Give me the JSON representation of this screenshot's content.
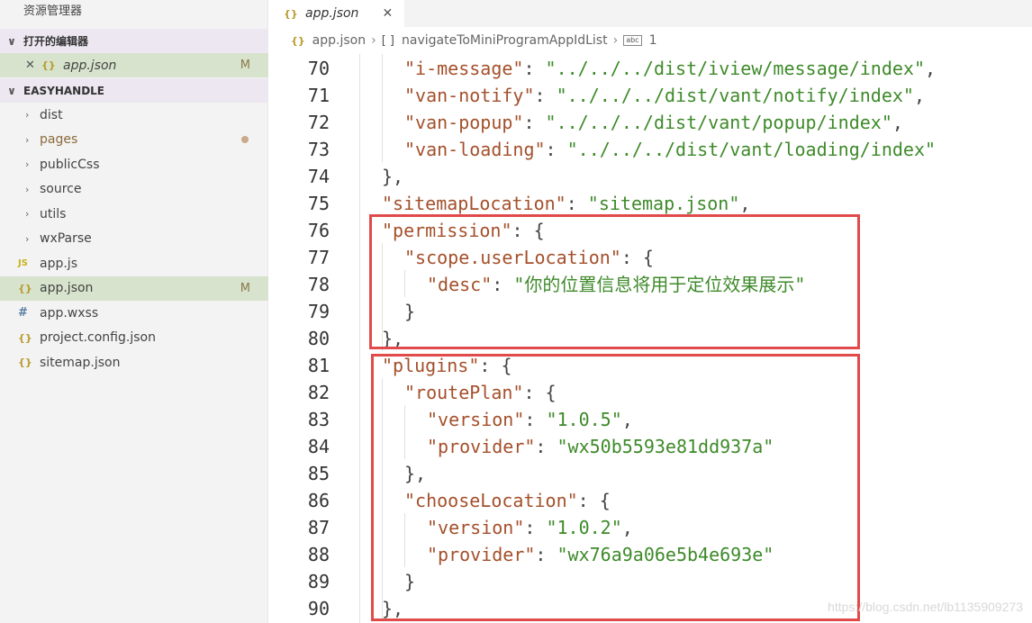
{
  "sidebar": {
    "title": "资源管理器",
    "open_editors_label": "打开的编辑器",
    "open_editors": [
      {
        "name": "app.json",
        "status": "M"
      }
    ],
    "project_label": "EASYHANDLE",
    "tree": [
      {
        "name": "dist",
        "type": "folder"
      },
      {
        "name": "pages",
        "type": "folder",
        "modified": true
      },
      {
        "name": "publicCss",
        "type": "folder"
      },
      {
        "name": "source",
        "type": "folder"
      },
      {
        "name": "utils",
        "type": "folder"
      },
      {
        "name": "wxParse",
        "type": "folder"
      },
      {
        "name": "app.js",
        "type": "js"
      },
      {
        "name": "app.json",
        "type": "json",
        "status": "M"
      },
      {
        "name": "app.wxss",
        "type": "css"
      },
      {
        "name": "project.config.json",
        "type": "json"
      },
      {
        "name": "sitemap.json",
        "type": "json"
      }
    ]
  },
  "tab": {
    "label": "app.json"
  },
  "breadcrumb": {
    "file": "app.json",
    "array": "navigateToMiniProgramAppIdList",
    "item": "1"
  },
  "icons": {
    "json": "{}",
    "js": "JS",
    "css": "#",
    "chevron_right": "›",
    "chevron_down": "∨",
    "close": "✕",
    "brackets": "[ ]",
    "abc": "abc"
  },
  "colors": {
    "key": "#a4502b",
    "string": "#3e8a2a",
    "highlight": "#e14a4a",
    "active_row": "#d7e3cc"
  },
  "editor": {
    "lines": [
      {
        "n": "70",
        "indent": 2,
        "tokens": [
          [
            "k",
            "\"i-message\""
          ],
          [
            "p",
            ": "
          ],
          [
            "s",
            "\"../../../dist/iview/message/index\""
          ],
          [
            "p",
            ","
          ]
        ]
      },
      {
        "n": "71",
        "indent": 2,
        "tokens": [
          [
            "k",
            "\"van-notify\""
          ],
          [
            "p",
            ": "
          ],
          [
            "s",
            "\"../../../dist/vant/notify/index\""
          ],
          [
            "p",
            ","
          ]
        ]
      },
      {
        "n": "72",
        "indent": 2,
        "tokens": [
          [
            "k",
            "\"van-popup\""
          ],
          [
            "p",
            ": "
          ],
          [
            "s",
            "\"../../../dist/vant/popup/index\""
          ],
          [
            "p",
            ","
          ]
        ]
      },
      {
        "n": "73",
        "indent": 2,
        "tokens": [
          [
            "k",
            "\"van-loading\""
          ],
          [
            "p",
            ": "
          ],
          [
            "s",
            "\"../../../dist/vant/loading/index\""
          ]
        ]
      },
      {
        "n": "74",
        "indent": 1,
        "tokens": [
          [
            "p",
            "},"
          ]
        ]
      },
      {
        "n": "75",
        "indent": 1,
        "tokens": [
          [
            "k",
            "\"sitemapLocation\""
          ],
          [
            "p",
            ": "
          ],
          [
            "s",
            "\"sitemap.json\""
          ],
          [
            "p",
            ","
          ]
        ]
      },
      {
        "n": "76",
        "indent": 1,
        "tokens": [
          [
            "k",
            "\"permission\""
          ],
          [
            "p",
            ": {"
          ]
        ]
      },
      {
        "n": "77",
        "indent": 2,
        "tokens": [
          [
            "k",
            "\"scope.userLocation\""
          ],
          [
            "p",
            ": {"
          ]
        ]
      },
      {
        "n": "78",
        "indent": 3,
        "tokens": [
          [
            "k",
            "\"desc\""
          ],
          [
            "p",
            ": "
          ],
          [
            "s",
            "\"你的位置信息将用于定位效果展示\""
          ]
        ]
      },
      {
        "n": "79",
        "indent": 2,
        "tokens": [
          [
            "p",
            "}"
          ]
        ]
      },
      {
        "n": "80",
        "indent": 1,
        "tokens": [
          [
            "p",
            "},"
          ]
        ]
      },
      {
        "n": "81",
        "indent": 1,
        "tokens": [
          [
            "k",
            "\"plugins\""
          ],
          [
            "p",
            ": {"
          ]
        ]
      },
      {
        "n": "82",
        "indent": 2,
        "tokens": [
          [
            "k",
            "\"routePlan\""
          ],
          [
            "p",
            ": {"
          ]
        ]
      },
      {
        "n": "83",
        "indent": 3,
        "tokens": [
          [
            "k",
            "\"version\""
          ],
          [
            "p",
            ": "
          ],
          [
            "s",
            "\"1.0.5\""
          ],
          [
            "p",
            ","
          ]
        ]
      },
      {
        "n": "84",
        "indent": 3,
        "tokens": [
          [
            "k",
            "\"provider\""
          ],
          [
            "p",
            ": "
          ],
          [
            "s",
            "\"wx50b5593e81dd937a\""
          ]
        ]
      },
      {
        "n": "85",
        "indent": 2,
        "tokens": [
          [
            "p",
            "},"
          ]
        ]
      },
      {
        "n": "86",
        "indent": 2,
        "tokens": [
          [
            "k",
            "\"chooseLocation\""
          ],
          [
            "p",
            ": {"
          ]
        ]
      },
      {
        "n": "87",
        "indent": 3,
        "tokens": [
          [
            "k",
            "\"version\""
          ],
          [
            "p",
            ": "
          ],
          [
            "s",
            "\"1.0.2\""
          ],
          [
            "p",
            ","
          ]
        ]
      },
      {
        "n": "88",
        "indent": 3,
        "tokens": [
          [
            "k",
            "\"provider\""
          ],
          [
            "p",
            ": "
          ],
          [
            "s",
            "\"wx76a9a06e5b4e693e\""
          ]
        ]
      },
      {
        "n": "89",
        "indent": 2,
        "tokens": [
          [
            "p",
            "}"
          ]
        ]
      },
      {
        "n": "90",
        "indent": 1,
        "tokens": [
          [
            "p",
            "},"
          ]
        ]
      }
    ]
  },
  "watermark": "https://blog.csdn.net/lb1135909273"
}
